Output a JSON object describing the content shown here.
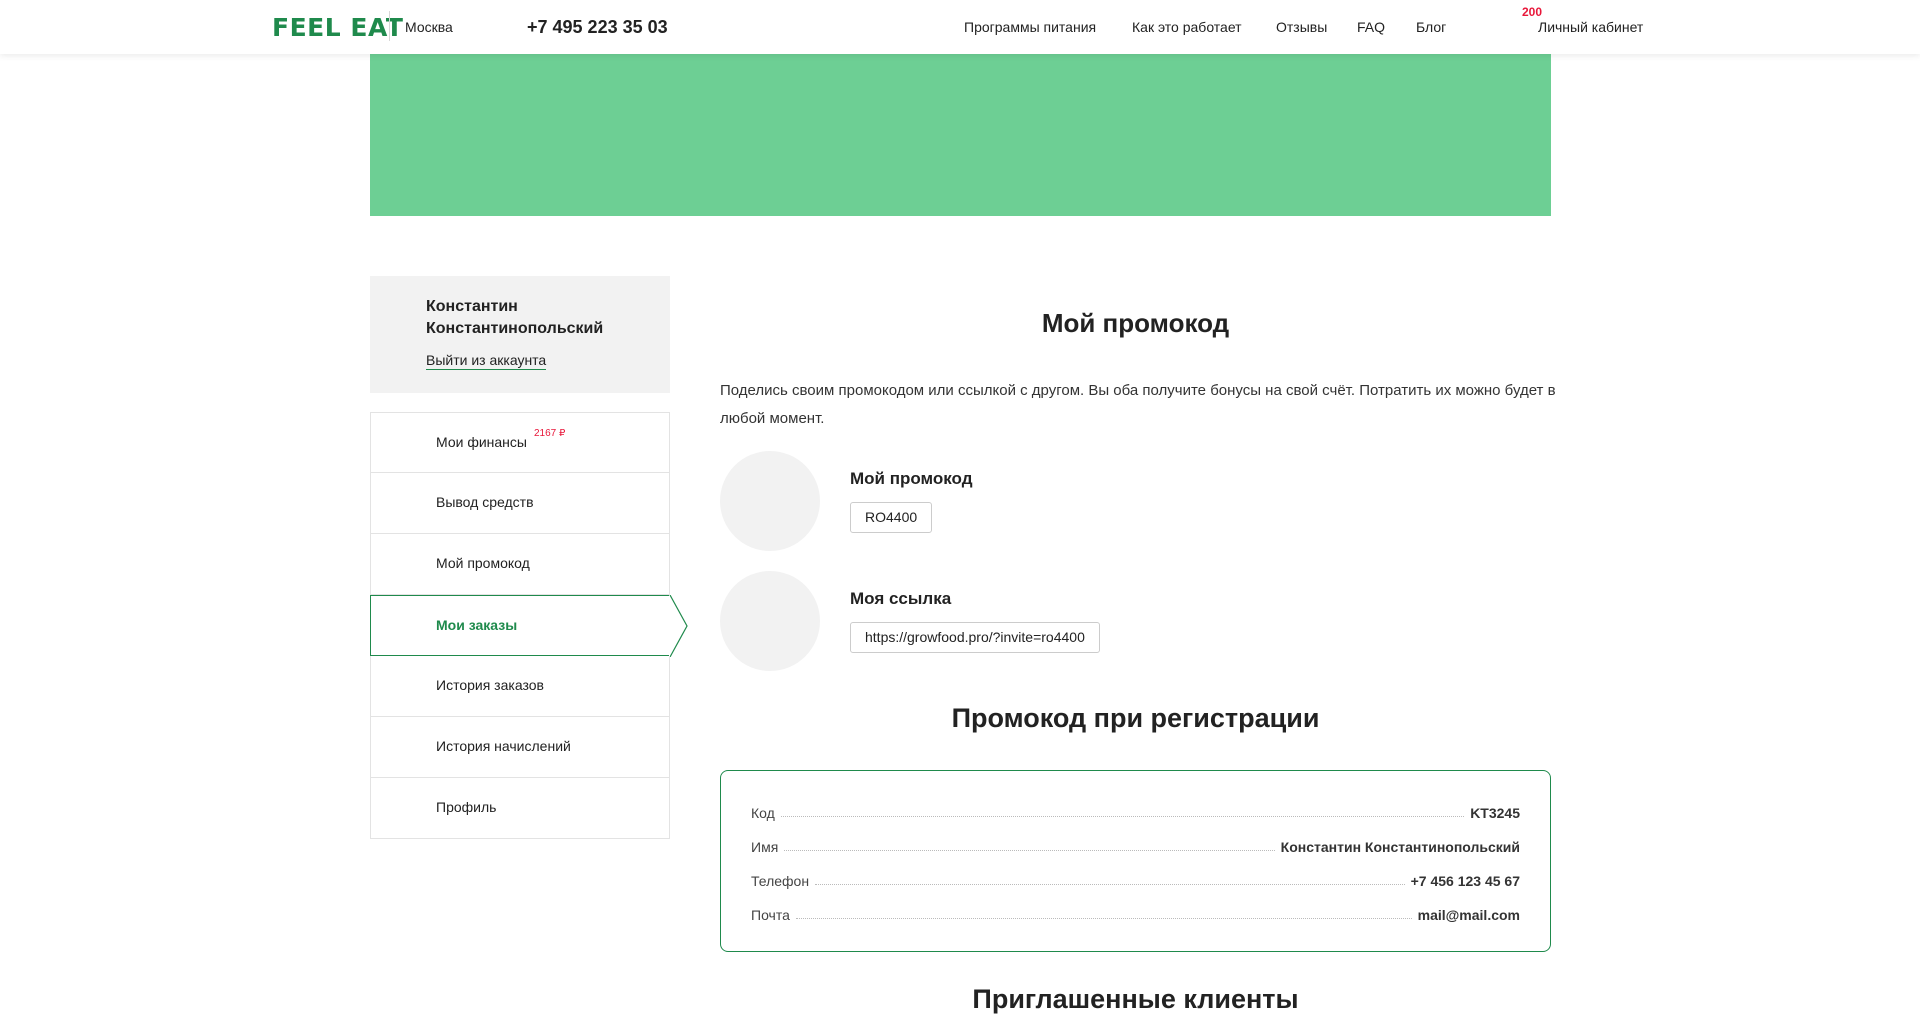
{
  "header": {
    "logo": "FEEL EAT",
    "city": "Москва",
    "phone": "+7 495 223 35 03",
    "nav": [
      "Программы питания",
      "Как это работает",
      "Отзывы",
      "FAQ",
      "Блог"
    ],
    "cabinet_badge": "200",
    "cabinet_label": "Личный кабинет"
  },
  "user": {
    "name": "Константин Константинопольский",
    "logout": "Выйти из аккаунта"
  },
  "menu": {
    "items": [
      {
        "label": "Мои финансы",
        "badge": "2167 ₽"
      },
      {
        "label": "Вывод средств"
      },
      {
        "label": "Мой промокод"
      },
      {
        "label": "Мои заказы",
        "active": true
      },
      {
        "label": "История заказов"
      },
      {
        "label": "История начислений"
      },
      {
        "label": "Профиль"
      }
    ]
  },
  "main": {
    "title": "Мой промокод",
    "intro": "Поделись своим промокодом или ссылкой с другом. Вы оба получите бонусы на свой счёт. Потратить их можно будет в любой момент.",
    "promo_label": "Мой промокод",
    "promo_code": "RO4400",
    "link_label": "Моя ссылка",
    "link_value": "https://growfood.pro/?invite=ro4400"
  },
  "registration": {
    "title": "Промокод при регистрации",
    "rows": [
      {
        "key": "Код",
        "value": "KT3245"
      },
      {
        "key": "Имя",
        "value": "Константин Константинопольский"
      },
      {
        "key": "Телефон",
        "value": "+7 456 123 45 67"
      },
      {
        "key": "Почта",
        "value": "mail@mail.com"
      }
    ]
  },
  "invited": {
    "title": "Приглашенные клиенты"
  },
  "colors": {
    "brand_green": "#1f8a4c",
    "banner_green": "#6dcf94",
    "badge_red": "#e8173a"
  }
}
